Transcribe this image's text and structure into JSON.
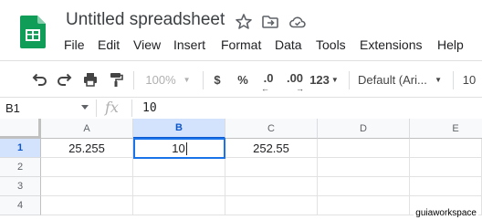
{
  "title_bar": {
    "doc_title": "Untitled spreadsheet",
    "icons": [
      "star-icon",
      "move-folder-icon",
      "cloud-status-icon"
    ]
  },
  "menu": [
    "File",
    "Edit",
    "View",
    "Insert",
    "Format",
    "Data",
    "Tools",
    "Extensions",
    "Help"
  ],
  "toolbar": {
    "zoom": "100%",
    "currency": "$",
    "percent": "%",
    "decrease_decimal": ".0",
    "increase_decimal": ".00",
    "more_formats": "123",
    "font": "Default (Ari...",
    "font_size": "10"
  },
  "formula_bar": {
    "name_box": "B1",
    "fx": "fx",
    "value": "10"
  },
  "grid": {
    "columns": [
      "A",
      "B",
      "C",
      "D",
      "E"
    ],
    "rows": [
      "1",
      "2",
      "3",
      "4"
    ],
    "cells": {
      "A1": "25.255",
      "B1": "10",
      "C1": "252.55"
    },
    "selected_cell": "B1"
  },
  "watermark": "guiaworkspace",
  "colors": {
    "accent": "#1a73e8",
    "selected_header": "#d3e3fd",
    "sheets_green": "#0f9d58"
  }
}
